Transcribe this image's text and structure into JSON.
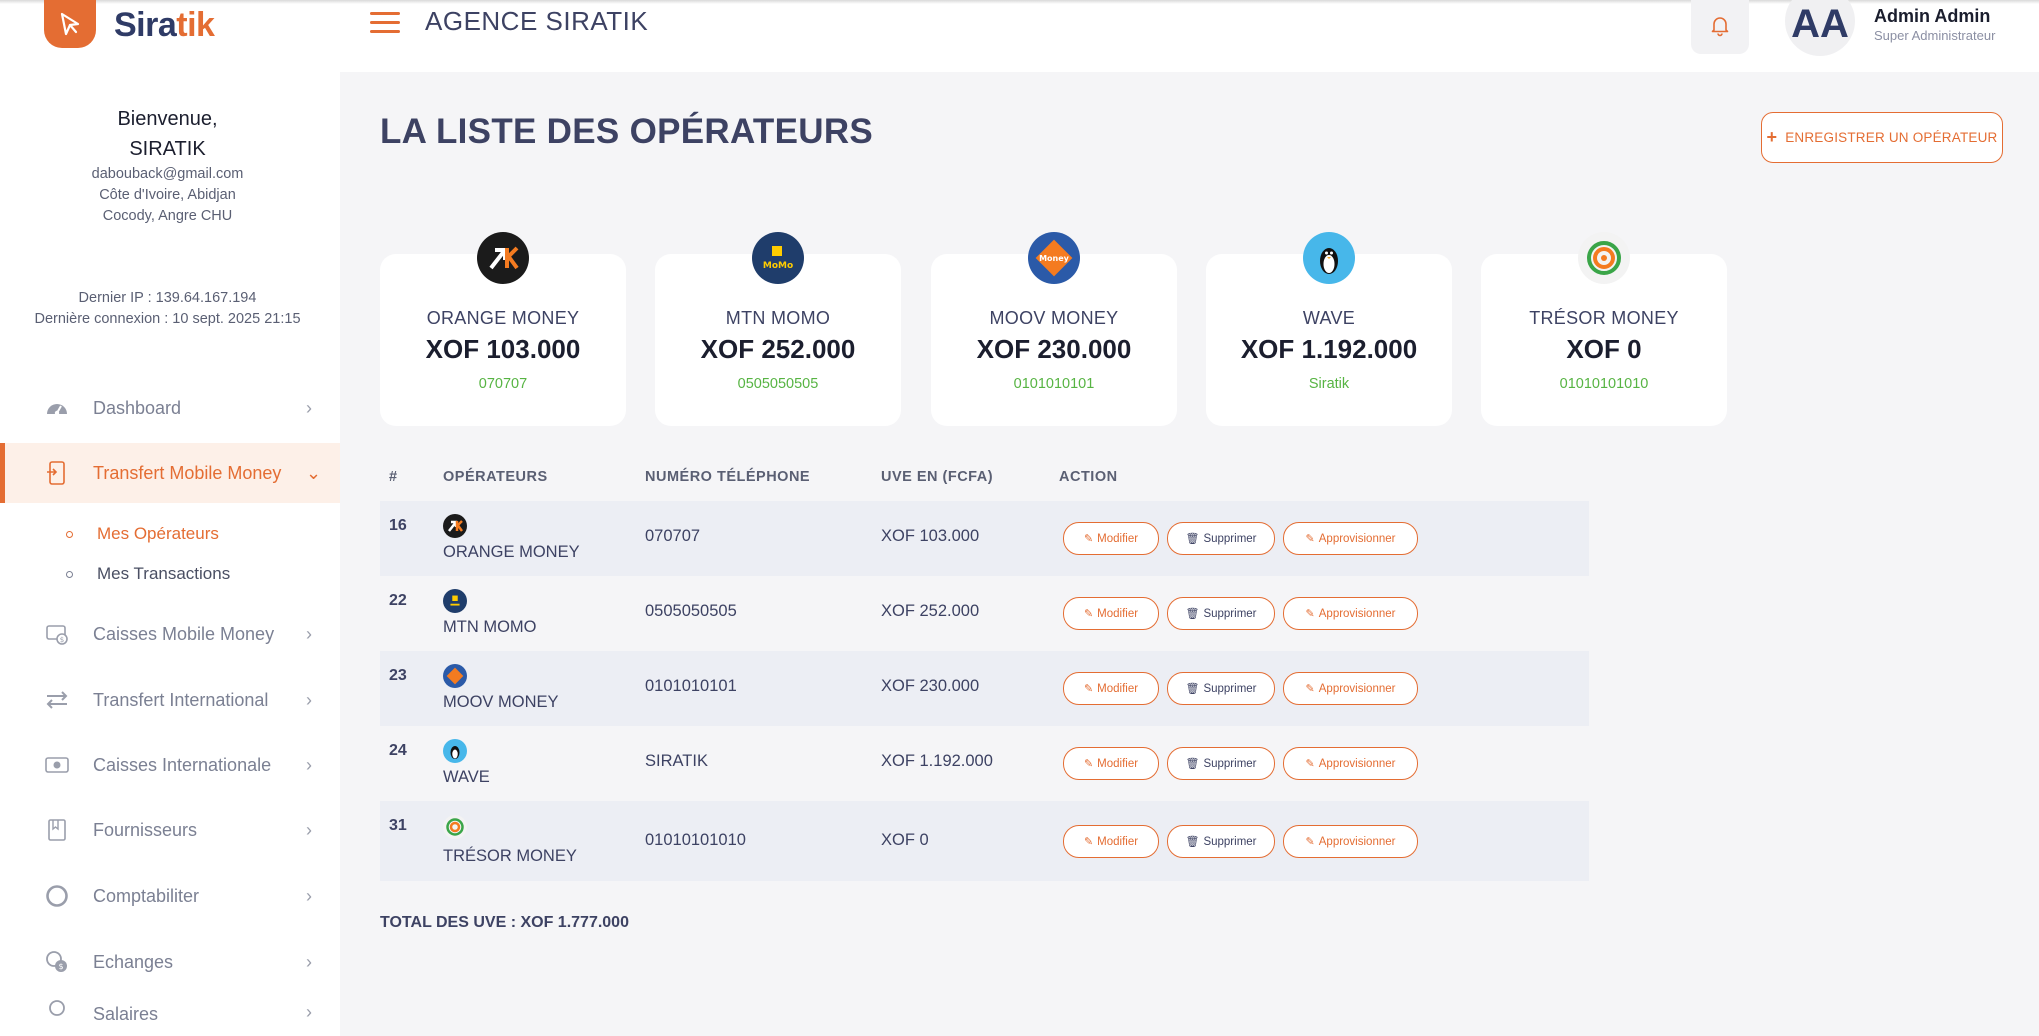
{
  "app": {
    "logo_text_main": "Sira",
    "logo_text_accent": "tik",
    "agency_title": "AGENCE SIRATIK"
  },
  "user": {
    "initials": "AA",
    "name": "Admin Admin",
    "role": "Super Administrateur"
  },
  "sidebar": {
    "welcome_line1": "Bienvenue,",
    "welcome_line2": "SIRATIK",
    "email": "dabouback@gmail.com",
    "location": "Côte d'Ivoire, Abidjan",
    "address": "Cocody, Angre CHU",
    "last_ip": "Dernier IP : 139.64.167.194",
    "last_login": "Dernière connexion : 10 sept. 2025 21:15",
    "items": [
      {
        "label": "Dashboard",
        "icon": "dashboard-gauge-icon"
      },
      {
        "label": "Transfert Mobile Money",
        "icon": "mobile-transfer-icon"
      },
      {
        "label": "Caisses Mobile Money",
        "icon": "cash-register-icon"
      },
      {
        "label": "Transfert International",
        "icon": "exchange-arrows-icon"
      },
      {
        "label": "Caisses Internationale",
        "icon": "money-bill-icon"
      },
      {
        "label": "Fournisseurs",
        "icon": "book-icon"
      },
      {
        "label": "Comptabiliter",
        "icon": "circle-icon"
      },
      {
        "label": "Echanges",
        "icon": "coins-icon"
      },
      {
        "label": "Salaires",
        "icon": "user-icon"
      }
    ],
    "sub_items": [
      {
        "label": "Mes Opérateurs"
      },
      {
        "label": "Mes Transactions"
      }
    ]
  },
  "main": {
    "page_title": "LA LISTE DES OPÉRATEURS",
    "add_button_label": "ENREGISTRER UN OPÉRATEUR",
    "cards": [
      {
        "name": "ORANGE MONEY",
        "amount": "XOF 103.000",
        "phone": "070707"
      },
      {
        "name": "MTN MOMO",
        "amount": "XOF 252.000",
        "phone": "0505050505"
      },
      {
        "name": "MOOV MONEY",
        "amount": "XOF 230.000",
        "phone": "0101010101"
      },
      {
        "name": "WAVE",
        "amount": "XOF 1.192.000",
        "phone": "Siratik"
      },
      {
        "name": "TRÉSOR MONEY",
        "amount": "XOF 0",
        "phone": "01010101010"
      }
    ],
    "table": {
      "headers": [
        "#",
        "OPÉRATEURS",
        "NUMÉRO TÉLÉPHONE",
        "UVE EN (FCFA)",
        "ACTION"
      ],
      "rows": [
        {
          "id": "16",
          "operator": "ORANGE MONEY",
          "phone": "070707",
          "uve": "XOF 103.000"
        },
        {
          "id": "22",
          "operator": "MTN MOMO",
          "phone": "0505050505",
          "uve": "XOF 252.000"
        },
        {
          "id": "23",
          "operator": "MOOV MONEY",
          "phone": "0101010101",
          "uve": "XOF 230.000"
        },
        {
          "id": "24",
          "operator": "WAVE",
          "phone": "SIRATIK",
          "uve": "XOF 1.192.000"
        },
        {
          "id": "31",
          "operator": "TRÉSOR MONEY",
          "phone": "01010101010",
          "uve": "XOF 0"
        }
      ],
      "actions": {
        "modify": "Modifier",
        "delete": "Supprimer",
        "supply": "Approvisionner"
      }
    },
    "total": "TOTAL DES UVE : XOF 1.777.000"
  },
  "colors": {
    "accent": "#e46d33",
    "text_dark": "#3d4263",
    "phone_green": "#57b443",
    "orange_logo_bg": "#1b1b1b",
    "mtn_logo_bg": "#1f3d6b",
    "moov_logo_bg": "#2b5aa8",
    "wave_logo_bg": "#47b7ea",
    "tresor_logo_bg": "#f3f3f3"
  }
}
